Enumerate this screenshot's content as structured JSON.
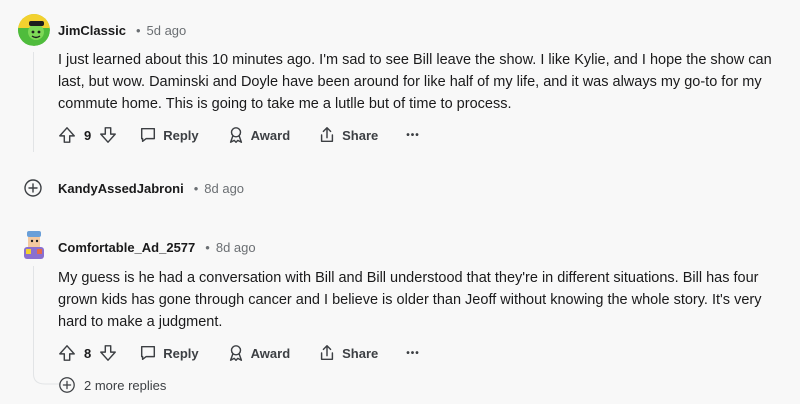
{
  "comments": [
    {
      "username": "JimClassic",
      "age": "5d ago",
      "body": "I just learned about this 10 minutes ago. I'm sad to see Bill leave the show. I like Kylie, and I hope the show can last, but wow. Daminski and Doyle have been around for like half of my life, and it was always my go-to for my commute home. This is going to take me a lutlle but of time to process.",
      "votes": "9",
      "reply_label": "Reply",
      "award_label": "Award",
      "share_label": "Share",
      "more_label": "•••"
    },
    {
      "username": "KandyAssedJabroni",
      "age": "8d ago"
    },
    {
      "username": "Comfortable_Ad_2577",
      "age": "8d ago",
      "body": "My guess is he had a conversation with Bill and Bill understood that they're in different situations. Bill has four grown kids has gone through cancer and I believe is older than Jeoff without knowing the whole story. It's very hard to make a judgment.",
      "votes": "8",
      "reply_label": "Reply",
      "award_label": "Award",
      "share_label": "Share",
      "more_label": "•••"
    }
  ],
  "more_replies_label": "2 more replies",
  "separator": "•",
  "colors": {
    "text": "#1a1a1b",
    "meta": "#6b6f73",
    "action": "#3c3f43",
    "background": "#f8f8f8"
  },
  "icons": [
    "upvote-icon",
    "downvote-icon",
    "reply-bubble-icon",
    "award-icon",
    "share-icon",
    "more-options-icon",
    "expand-plus-icon"
  ]
}
